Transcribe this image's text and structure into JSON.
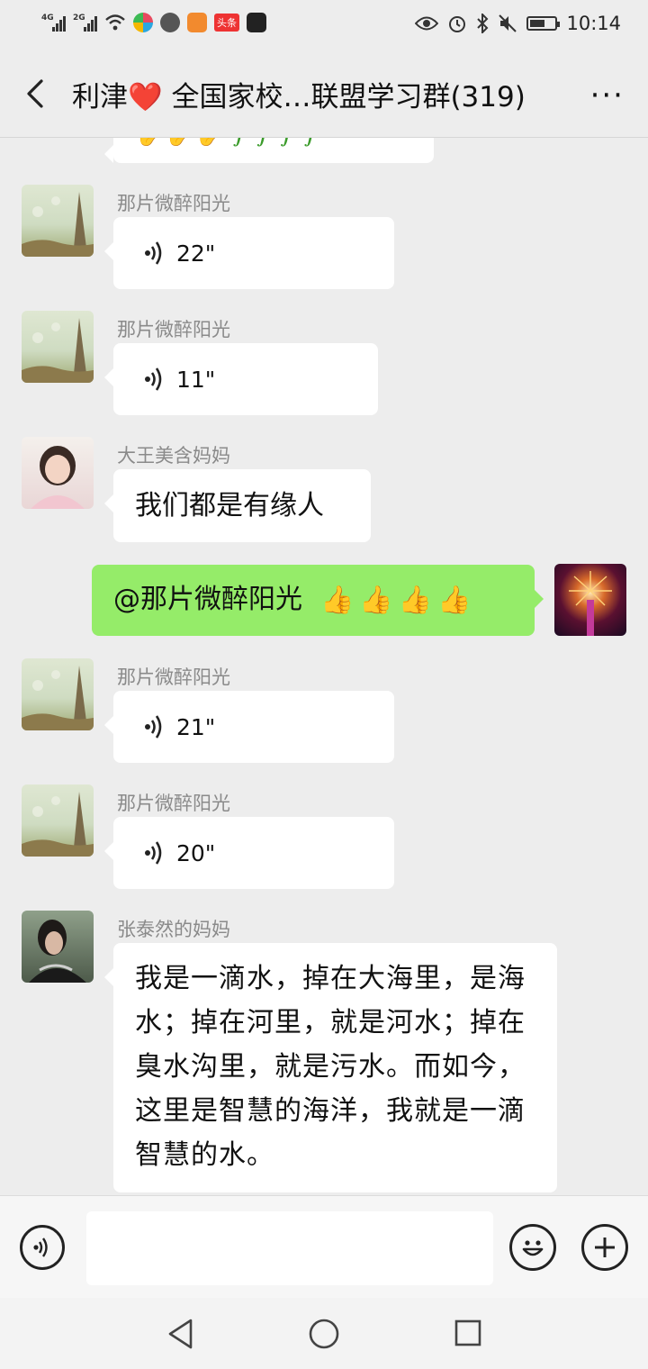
{
  "status_bar": {
    "signal_1_label": "4G",
    "signal_2_label": "2G",
    "app_badge_text": "头条",
    "time": "10:14"
  },
  "header": {
    "title": "利津❤️ 全国家校…联盟学习群(319)",
    "more_label": "···"
  },
  "messages": [
    {
      "sender": "那片微醉阳光",
      "type": "voice",
      "duration": "22\""
    },
    {
      "sender": "那片微醉阳光",
      "type": "voice",
      "duration": "11\""
    },
    {
      "sender": "大王美含妈妈",
      "type": "text",
      "text": "我们都是有缘人"
    },
    {
      "sender": "",
      "type": "text",
      "outgoing": true,
      "text": "@那片微醉阳光",
      "emoji_count": 4
    },
    {
      "sender": "那片微醉阳光",
      "type": "voice",
      "duration": "21\""
    },
    {
      "sender": "那片微醉阳光",
      "type": "voice",
      "duration": "20\""
    },
    {
      "sender": "张泰然的妈妈",
      "type": "text",
      "text": "我是一滴水，掉在大海里，是海水；掉在河里，就是河水；掉在臭水沟里，就是污水。而如今，这里是智慧的海洋，我就是一滴智慧的水。"
    }
  ],
  "icons": {
    "back": "chevron-left-icon",
    "voice_input": "voice-icon",
    "emoji": "smiley-icon",
    "add": "plus-icon",
    "nav_back": "triangle-back-icon",
    "nav_home": "circle-home-icon",
    "nav_recent": "square-recent-icon"
  },
  "colors": {
    "outgoing_bubble": "#95ec69",
    "incoming_bubble": "#ffffff",
    "background": "#ededed"
  }
}
